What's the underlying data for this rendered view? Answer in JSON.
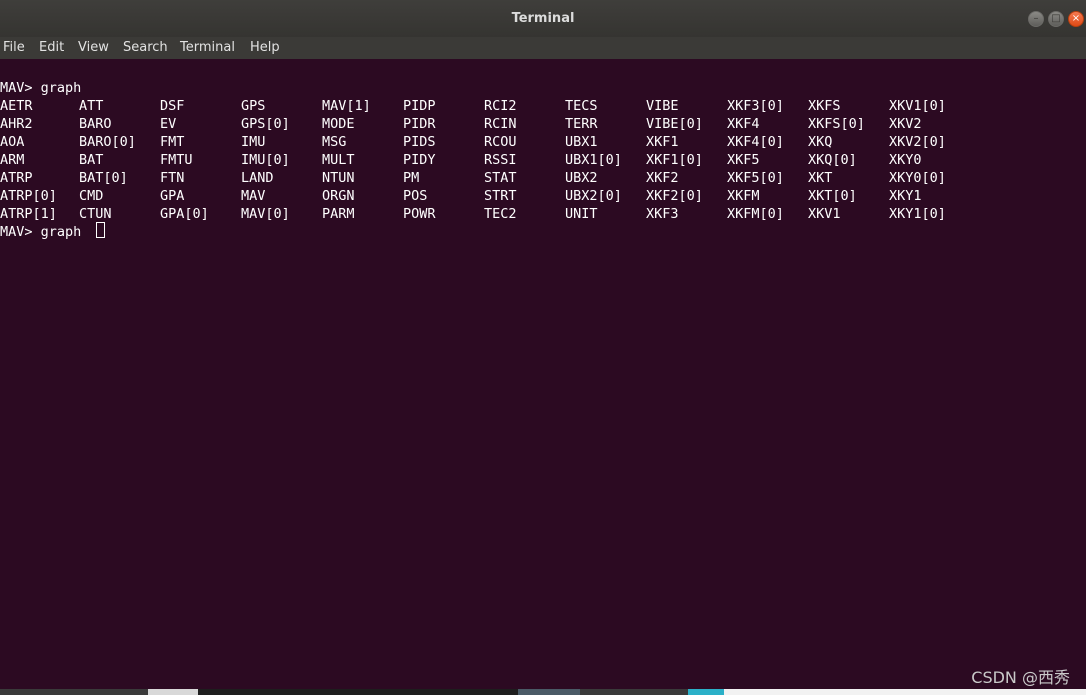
{
  "window": {
    "title": "Terminal",
    "buttons": {
      "minimize": "–",
      "maximize": "□",
      "close": "×"
    }
  },
  "menu": [
    "File",
    "Edit",
    "View",
    "Search",
    "Terminal",
    "Help"
  ],
  "terminal": {
    "prompt_line_1": "MAV> graph",
    "rows": [
      [
        "AETR",
        "ATT",
        "DSF",
        "GPS",
        "MAV[1]",
        "PIDP",
        "RCI2",
        "TECS",
        "VIBE",
        "XKF3[0]",
        "XKFS",
        "XKV1[0]"
      ],
      [
        "AHR2",
        "BARO",
        "EV",
        "GPS[0]",
        "MODE",
        "PIDR",
        "RCIN",
        "TERR",
        "VIBE[0]",
        "XKF4",
        "XKFS[0]",
        "XKV2"
      ],
      [
        "AOA",
        "BARO[0]",
        "FMT",
        "IMU",
        "MSG",
        "PIDS",
        "RCOU",
        "UBX1",
        "XKF1",
        "XKF4[0]",
        "XKQ",
        "XKV2[0]"
      ],
      [
        "ARM",
        "BAT",
        "FMTU",
        "IMU[0]",
        "MULT",
        "PIDY",
        "RSSI",
        "UBX1[0]",
        "XKF1[0]",
        "XKF5",
        "XKQ[0]",
        "XKY0"
      ],
      [
        "ATRP",
        "BAT[0]",
        "FTN",
        "LAND",
        "NTUN",
        "PM",
        "STAT",
        "UBX2",
        "XKF2",
        "XKF5[0]",
        "XKT",
        "XKY0[0]"
      ],
      [
        "ATRP[0]",
        "CMD",
        "GPA",
        "MAV",
        "ORGN",
        "POS",
        "STRT",
        "UBX2[0]",
        "XKF2[0]",
        "XKFM",
        "XKT[0]",
        "XKY1"
      ],
      [
        "ATRP[1]",
        "CTUN",
        "GPA[0]",
        "MAV[0]",
        "PARM",
        "POWR",
        "TEC2",
        "UNIT",
        "XKF3",
        "XKFM[0]",
        "XKV1",
        "XKY1[0]"
      ]
    ],
    "prompt_line_2": "MAV> graph "
  },
  "watermark": "CSDN @西秀",
  "colors": {
    "terminal_bg": "#2c0a22",
    "titlebar_bg": "#3f3e3b",
    "menubar_bg": "#3b3a37",
    "text": "#ffffff",
    "close_button": "#e8551f"
  }
}
